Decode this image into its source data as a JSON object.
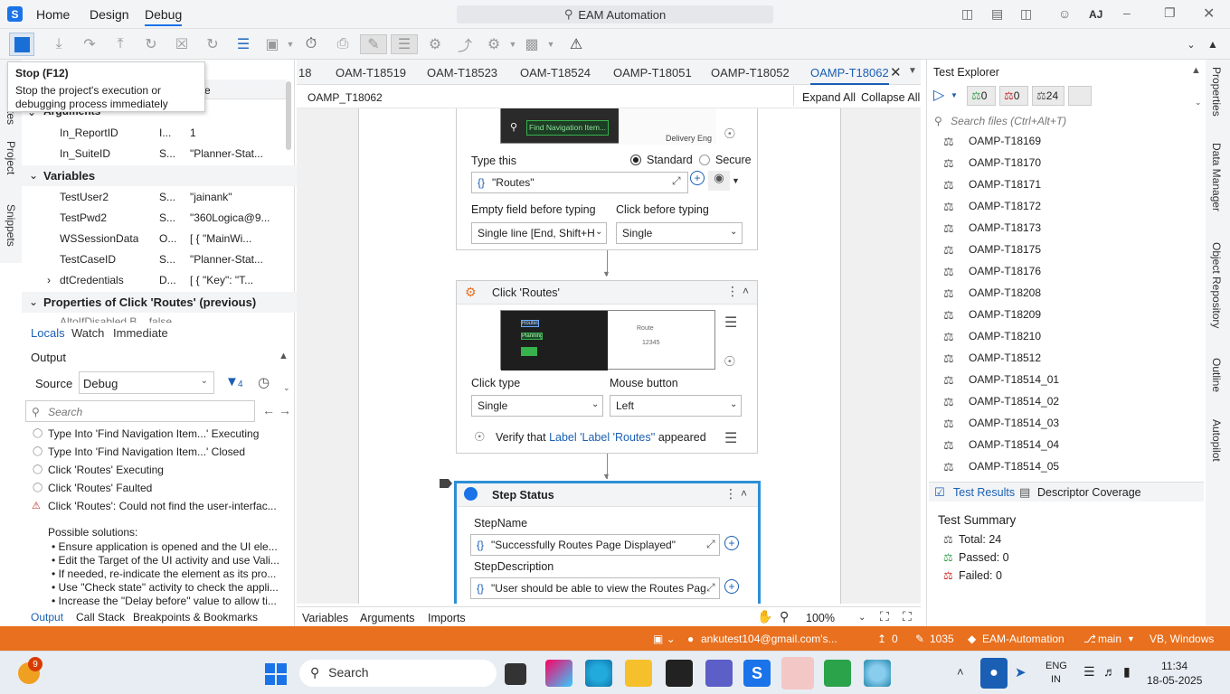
{
  "titlebar": {
    "menus": [
      "Home",
      "Design",
      "Debug"
    ],
    "search": "EAM Automation",
    "user": "AJ"
  },
  "tooltip": {
    "title": "Stop (F12)",
    "desc": "Stop the project's execution or debugging process immediately"
  },
  "locals": {
    "section_args": "Arguments",
    "header_e": "e",
    "args": [
      {
        "name": "In_ReportID",
        "type": "I...",
        "value": "1"
      },
      {
        "name": "In_SuiteID",
        "type": "S...",
        "value": "\"Planner-Stat..."
      }
    ],
    "section_vars": "Variables",
    "vars": [
      {
        "name": "TestUser2",
        "type": "S...",
        "value": "\"jainank\""
      },
      {
        "name": "TestPwd2",
        "type": "S...",
        "value": "\"360Logica@9..."
      },
      {
        "name": "WSSessionData",
        "type": "O...",
        "value": "[ {   \"MainWi..."
      },
      {
        "name": "TestCaseID",
        "type": "S...",
        "value": "\"Planner-Stat..."
      },
      {
        "name": "dtCredentials",
        "type": "D...",
        "value": "[ {   \"Key\": \"T..."
      }
    ],
    "section_props": "Properties of Click 'Routes' (previous)",
    "partial": "AltoIfDisabled    B...   false",
    "tabs": [
      "Locals",
      "Watch",
      "Immediate"
    ]
  },
  "left_vert": [
    "tes",
    "Project",
    "Snippets"
  ],
  "output": {
    "title": "Output",
    "source_label": "Source",
    "source": "Debug",
    "filter_count": "4",
    "search_placeholder": "Search",
    "lines": [
      "Type Into 'Find Navigation Item...' Executing",
      "Type Into 'Find Navigation Item...' Closed",
      "Click 'Routes' Executing",
      "Click 'Routes' Faulted",
      "Click 'Routes': Could not find the user-interfac..."
    ],
    "solutions_title": "Possible solutions:",
    "solutions": [
      "Ensure application is opened and the UI ele...",
      "Edit the Target of the UI activity and use Vali...",
      "If needed, re-indicate the element as its pro...",
      "Use \"Check state\" activity to check the appli...",
      "Increase the \"Delay before\" value to allow ti..."
    ],
    "tabs": [
      "Output",
      "Call Stack",
      "Breakpoints & Bookmarks"
    ]
  },
  "doc_tabs": [
    "18",
    "OAM-T18519",
    "OAM-T18523",
    "OAM-T18524",
    "OAMP-T18051",
    "OAMP-T18052",
    "OAMP-T18062"
  ],
  "breadcrumb": "OAMP_T18062",
  "expand_all": "Expand All",
  "collapse_all": "Collapse All",
  "type_into": {
    "type_this": "Type this",
    "standard": "Standard",
    "secure": "Secure",
    "value": "\"Routes\"",
    "empty_label": "Empty field before typing",
    "empty_value": "Single line [End, Shift+H",
    "click_label": "Click before typing",
    "click_value": "Single",
    "thumb_text": "Find Navigation Item...",
    "thumb_text2": "Delivery Eng"
  },
  "click": {
    "title": "Click 'Routes'",
    "click_type_label": "Click type",
    "click_type": "Single",
    "mouse_label": "Mouse button",
    "mouse": "Left",
    "verify_prefix": "Verify that",
    "verify_link": "Label 'Label 'Routes''",
    "verify_suffix": "appeared",
    "thumb_route": "Route",
    "thumb_num": "12345",
    "thumb_items": [
      "Routes",
      "Planning"
    ]
  },
  "step": {
    "title": "Step Status",
    "name_label": "StepName",
    "name_value": "\"Successfully Routes Page Displayed\"",
    "desc_label": "StepDescription",
    "desc_value": "\"User should be able to view the Routes Pag"
  },
  "bottom_tabs": [
    "Variables",
    "Arguments",
    "Imports"
  ],
  "zoom": "100%",
  "test_explorer": {
    "title": "Test Explorer",
    "counts": [
      "0",
      "0",
      "24"
    ],
    "search_placeholder": "Search files (Ctrl+Alt+T)",
    "items": [
      "OAMP-T18169",
      "OAMP-T18170",
      "OAMP-T18171",
      "OAMP-T18172",
      "OAMP-T18173",
      "OAMP-T18175",
      "OAMP-T18176",
      "OAMP-T18208",
      "OAMP-T18209",
      "OAMP-T18210",
      "OAMP-T18512",
      "OAMP-T18514_01",
      "OAMP-T18514_02",
      "OAMP-T18514_03",
      "OAMP-T18514_04",
      "OAMP-T18514_05"
    ],
    "tabs": [
      "Test Results",
      "Descriptor Coverage"
    ],
    "summary_title": "Test Summary",
    "total": "Total: 24",
    "passed": "Passed: 0",
    "failed": "Failed: 0"
  },
  "right_vert": [
    "Properties",
    "Data Manager",
    "Object Repository",
    "Outline",
    "Autopilot"
  ],
  "statusbar": {
    "email": "ankutest104@gmail.com's...",
    "up": "0",
    "edits": "1035",
    "project": "EAM-Automation",
    "branch": "main",
    "lang": "VB, Windows"
  },
  "taskbar": {
    "badge": "9",
    "search": "Search",
    "lang1": "ENG",
    "lang2": "IN",
    "time": "11:34",
    "date": "18-05-2025"
  },
  "colors": {
    "accent": "#1a73e8",
    "status": "#e8701f",
    "selected": "#2d8fd5"
  }
}
